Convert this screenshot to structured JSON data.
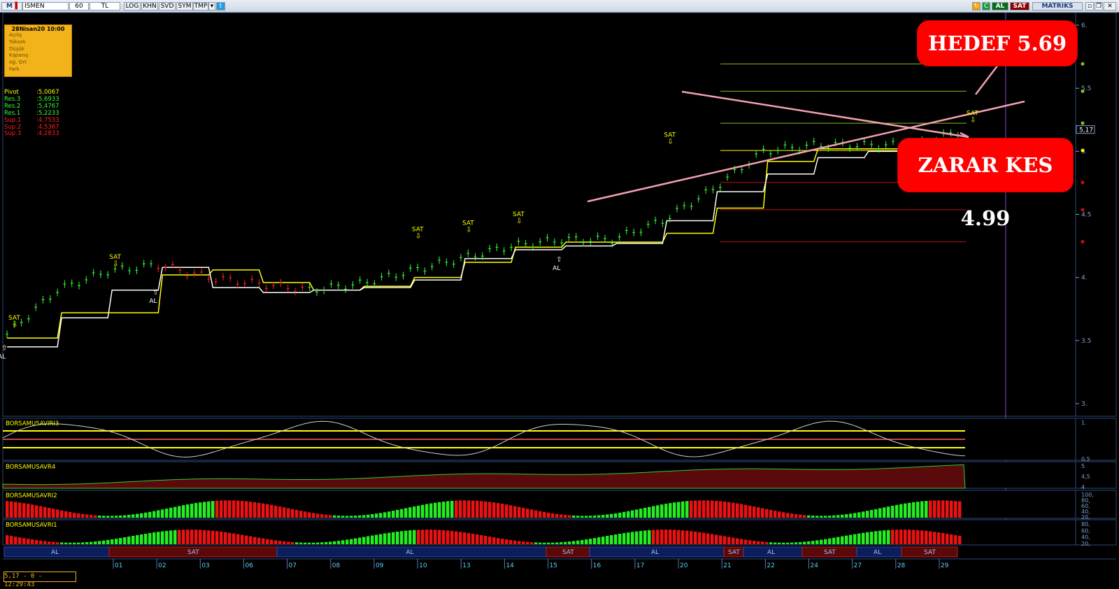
{
  "toolbar": {
    "symbol": "ISMEN",
    "period": "60",
    "currency": "TL",
    "buttons": [
      "LOG",
      "KHN",
      "SVD",
      "SYM",
      "TMP"
    ],
    "right_buttons": {
      "al": "AL",
      "sat": "SAT",
      "brand": "MATRIKS"
    },
    "icons": [
      "matriks-logo-icon",
      "chart-type-icon",
      "dropdown-icon",
      "twitter-icon",
      "refresh-icon",
      "green-c-icon",
      "minimize-icon",
      "restore-icon",
      "close-icon"
    ]
  },
  "info_box": {
    "date": "28Nisan20 10:00",
    "rows": [
      "Açılış",
      "Yüksek",
      "Düşük",
      "Kapanış",
      "Ağ. Ort",
      "Fark"
    ]
  },
  "pivots": [
    {
      "label": "Pivot",
      "value": ":5,0067",
      "color": "#ffff00"
    },
    {
      "label": "Res.3",
      "value": ":5,6933",
      "color": "#33ff33"
    },
    {
      "label": "Res.2",
      "value": ":5,4767",
      "color": "#33ff33"
    },
    {
      "label": "Res.1",
      "value": ":5,2233",
      "color": "#33ff33"
    },
    {
      "label": "Sup.1",
      "value": ":4,7533",
      "color": "#ff2020"
    },
    {
      "label": "Sup.2",
      "value": ":4,5367",
      "color": "#ff2020"
    },
    {
      "label": "Sup.3",
      "value": ":4,2833",
      "color": "#ff2020"
    }
  ],
  "callouts": {
    "target": "HEDEF 5.69",
    "stop": "ZARAR KES 4.99"
  },
  "price_axis": {
    "ticks": [
      "6.",
      "5.5",
      "5.",
      "4.5",
      "4.",
      "3.5",
      "3."
    ],
    "last_price": "5,17"
  },
  "chart_data": {
    "type": "line",
    "ylim": [
      2.9,
      6.1
    ],
    "x": [
      "01",
      "02",
      "03",
      "06",
      "07",
      "08",
      "09",
      "10",
      "13",
      "14",
      "15",
      "16",
      "17",
      "20",
      "21",
      "22",
      "24",
      "27",
      "28",
      "29"
    ],
    "series": [
      {
        "name": "price",
        "values": [
          3.55,
          3.9,
          4.05,
          4.1,
          4.0,
          3.95,
          3.9,
          3.95,
          4.05,
          4.15,
          4.25,
          4.3,
          4.3,
          4.45,
          4.7,
          5.0,
          5.05,
          5.05,
          5.05,
          5.17
        ]
      }
    ],
    "signals": [
      {
        "label": "SAT",
        "x": "01",
        "y": 3.6
      },
      {
        "label": "AL",
        "x": "01",
        "y": 3.48
      },
      {
        "label": "SAT",
        "x": "03",
        "y": 4.08
      },
      {
        "label": "AL",
        "x": "06",
        "y": 3.92
      },
      {
        "label": "SAT",
        "x": "13",
        "y": 4.3
      },
      {
        "label": "SAT",
        "x": "14",
        "y": 4.35
      },
      {
        "label": "SAT",
        "x": "15",
        "y": 4.42
      },
      {
        "label": "AL",
        "x": "16",
        "y": 4.18
      },
      {
        "label": "SAT",
        "x": "20",
        "y": 5.05
      },
      {
        "label": "SAT",
        "x": "29",
        "y": 5.22
      }
    ],
    "pivot_levels": [
      5.6933,
      5.4767,
      5.2233,
      5.0067,
      4.7533,
      4.5367,
      4.2833
    ]
  },
  "panels": [
    {
      "name": "BORSAMUSAVIRI3",
      "ticks": [
        "1.",
        "0,5"
      ]
    },
    {
      "name": "BORSAMUSAVR4",
      "ticks": [
        "5",
        "4,5",
        "4"
      ]
    },
    {
      "name": "BORSAMUSAVRI2",
      "ticks": [
        "100,",
        "80,",
        "60,",
        "40,",
        "20,"
      ]
    },
    {
      "name": "BORSAMUSAVRI1",
      "ticks": [
        "80,",
        "60,",
        "40,",
        "20,"
      ]
    }
  ],
  "signal_bar": [
    {
      "label": "AL",
      "kind": "al"
    },
    {
      "label": "SAT",
      "kind": "sat"
    },
    {
      "label": "AL",
      "kind": "al"
    },
    {
      "label": "SAT",
      "kind": "sat"
    },
    {
      "label": "AL",
      "kind": "al"
    },
    {
      "label": "SAT",
      "kind": "sat"
    },
    {
      "label": "AL",
      "kind": "al"
    },
    {
      "label": "SAT",
      "kind": "sat"
    },
    {
      "label": "AL",
      "kind": "al"
    },
    {
      "label": "SAT",
      "kind": "sat"
    }
  ],
  "date_axis": [
    "01",
    "02",
    "03",
    "06",
    "07",
    "08",
    "09",
    "10",
    "13",
    "14",
    "15",
    "16",
    "17",
    "20",
    "21",
    "22",
    "24",
    "27",
    "28",
    "29"
  ],
  "status": "5,17 - 0 - 12:29:43",
  "colors": {
    "yellow": "#ffff00",
    "white": "#ffffff",
    "green": "#33ff33",
    "red": "#ff2020",
    "pink": "#f4a0b0",
    "purple": "#8c4cc8"
  }
}
